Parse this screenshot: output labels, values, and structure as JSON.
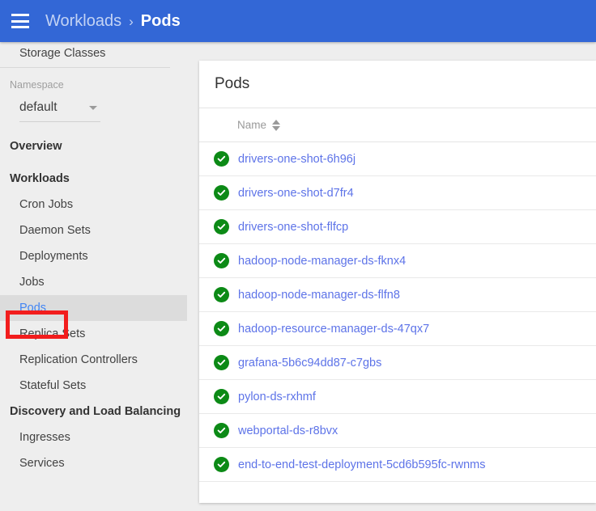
{
  "appbar": {
    "menu_icon": "hamburger-menu-icon",
    "breadcrumb_parent": "Workloads",
    "breadcrumb_separator": "›",
    "breadcrumb_current": "Pods",
    "background_color": "#3367d6"
  },
  "sidebar": {
    "scrolled_item": "Storage Classes",
    "namespace": {
      "label": "Namespace",
      "selected": "default",
      "caret_icon": "chevron-down-icon"
    },
    "groups": [
      {
        "header": "Overview",
        "items": []
      },
      {
        "header": "Workloads",
        "items": [
          "Cron Jobs",
          "Daemon Sets",
          "Deployments",
          "Jobs",
          "Pods",
          "Replica Sets",
          "Replication Controllers",
          "Stateful Sets"
        ]
      },
      {
        "header": "Discovery and Load Balancing",
        "items": [
          "Ingresses",
          "Services"
        ]
      }
    ],
    "selected_item": "Pods",
    "selected_color": "#4285f4",
    "selected_background": "#dcdcdc",
    "annotation_color": "#f21d1d"
  },
  "main": {
    "card_title": "Pods",
    "table": {
      "columns": [
        "",
        "Name"
      ],
      "sort_icon": "sort-ascending-descending-icon",
      "status_icon": "check-circle-icon",
      "status_color": "#0c8a16",
      "link_color": "#5d73e8",
      "rows": [
        {
          "status": "running",
          "name": "drivers-one-shot-6h96j"
        },
        {
          "status": "running",
          "name": "drivers-one-shot-d7fr4"
        },
        {
          "status": "running",
          "name": "drivers-one-shot-flfcp"
        },
        {
          "status": "running",
          "name": "hadoop-node-manager-ds-fknx4"
        },
        {
          "status": "running",
          "name": "hadoop-node-manager-ds-flfn8"
        },
        {
          "status": "running",
          "name": "hadoop-resource-manager-ds-47qx7"
        },
        {
          "status": "running",
          "name": "grafana-5b6c94dd87-c7gbs"
        },
        {
          "status": "running",
          "name": "pylon-ds-rxhmf"
        },
        {
          "status": "running",
          "name": "webportal-ds-r8bvx"
        },
        {
          "status": "running",
          "name": "end-to-end-test-deployment-5cd6b595fc-rwnms"
        }
      ]
    }
  }
}
